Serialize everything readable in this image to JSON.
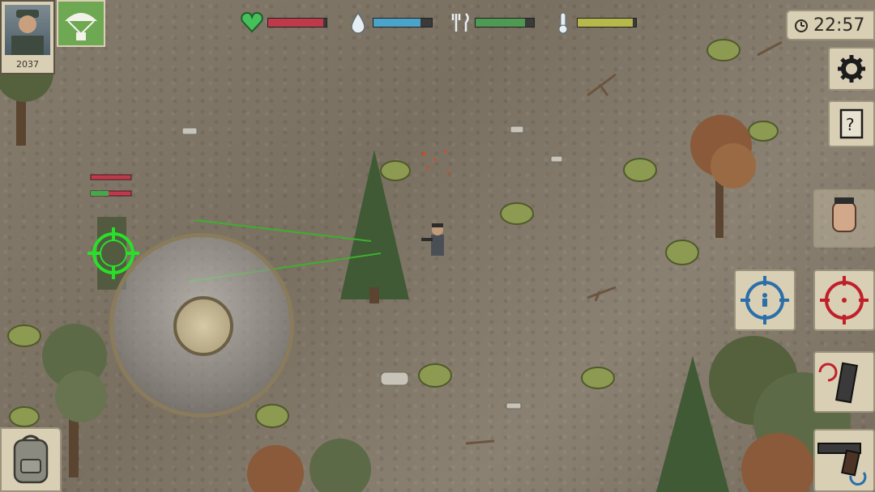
{
  "hud": {
    "player_score": "2037",
    "clock_time": "22:57",
    "stats": [
      {
        "name": "health",
        "icon": "heart-icon",
        "level": 0.95,
        "color": "#c0394b"
      },
      {
        "name": "thirst",
        "icon": "water-drop-icon",
        "level": 0.8,
        "color": "#4aa3c8"
      },
      {
        "name": "hunger",
        "icon": "fork-knife-icon",
        "level": 0.85,
        "color": "#4e9a52"
      },
      {
        "name": "temperature",
        "icon": "thermometer-icon",
        "level": 0.95,
        "color": "#b7b84a"
      }
    ],
    "colors": {
      "panel": "#d9cfb5",
      "target_player_blue": "#2a6fa8",
      "target_enemy_red": "#c0202a",
      "lock_green": "#28e028"
    }
  },
  "buttons": {
    "settings_icon": "gear-icon",
    "journal_icon": "notebook-icon",
    "melee_icon": "fist-icon",
    "aim_self_icon": "crosshair-person-icon",
    "aim_enemy_icon": "crosshair-red-icon",
    "reload_icon": "magazine-reload-icon",
    "weapon_icon": "pistol-icon",
    "backpack_icon": "backpack-icon",
    "airdrop_icon": "parachute-icon"
  }
}
